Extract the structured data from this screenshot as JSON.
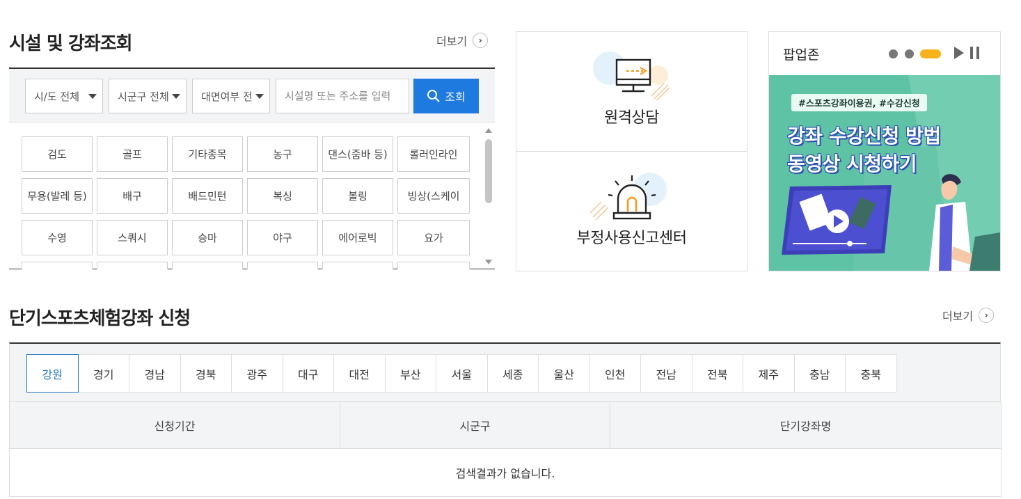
{
  "facility_section": {
    "title": "시설 및 강좌조회",
    "more_label": "더보기",
    "filters": {
      "sido": "시/도 전체",
      "sigungu": "시군구 전체",
      "mode": "대면여부 전체"
    },
    "search": {
      "placeholder": "시설명 또는 주소를 입력",
      "button_label": "조회"
    },
    "sports": [
      "검도",
      "골프",
      "기타종목",
      "농구",
      "댄스(줌바 등)",
      "롤러인라인",
      "무용(발레 등)",
      "배구",
      "배드민턴",
      "복싱",
      "볼링",
      "빙상(스케이",
      "수영",
      "스쿼시",
      "승마",
      "야구",
      "에어로빅",
      "요가",
      "",
      "",
      "",
      "",
      "",
      ""
    ]
  },
  "services": {
    "remote_label": "원격상담",
    "report_label": "부정사용신고센터"
  },
  "popup_zone": {
    "title": "팝업존",
    "banner": {
      "tag": "#스포츠강좌이용권, #수강신청",
      "line1": "강좌 수강신청 방법",
      "line2": "동영상 시청하기"
    },
    "active_slide": 3,
    "slide_count": 3
  },
  "short_section": {
    "title": "단기스포츠체험강좌 신청",
    "more_label": "더보기",
    "regions": [
      "강원",
      "경기",
      "경남",
      "경북",
      "광주",
      "대구",
      "대전",
      "부산",
      "서울",
      "세종",
      "울산",
      "인천",
      "전남",
      "전북",
      "제주",
      "충남",
      "충북"
    ],
    "active_region": "강원",
    "columns": [
      "신청기간",
      "시군구",
      "단기강좌명"
    ],
    "empty_message": "검색결과가 없습니다."
  },
  "colors": {
    "primary": "#1f7ae0",
    "active_tab": "#1a73c9",
    "banner_bg": "#5ec2a4",
    "accent_orange": "#f89a1c"
  }
}
